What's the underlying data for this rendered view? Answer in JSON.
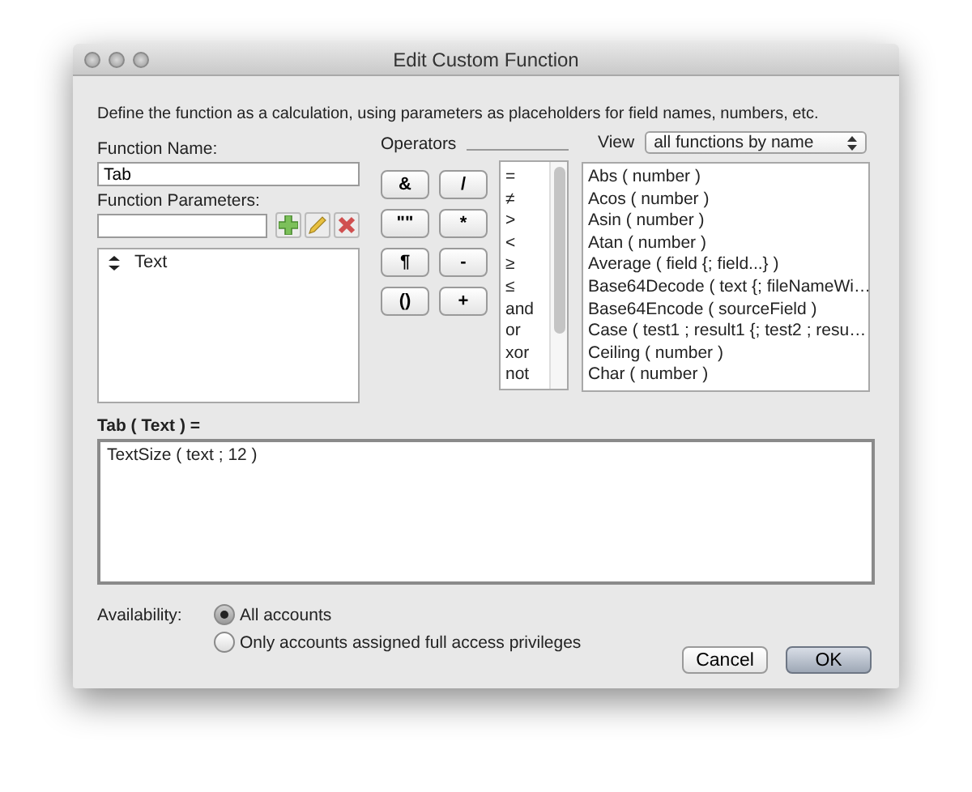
{
  "window": {
    "title": "Edit Custom Function"
  },
  "description": "Define the function as a calculation, using parameters as placeholders for field names, numbers, etc.",
  "function_name": {
    "label": "Function Name:",
    "value": "Tab"
  },
  "function_parameters": {
    "label": "Function Parameters:",
    "items": [
      {
        "label": "Text"
      }
    ]
  },
  "operators": {
    "label": "Operators",
    "buttons": [
      "&",
      "/",
      "\"\"",
      "*",
      "¶",
      "-",
      "()",
      "+"
    ],
    "list": [
      "=",
      "≠",
      ">",
      "<",
      "≥",
      "≤",
      "and",
      "or",
      "xor",
      "not"
    ]
  },
  "view": {
    "label": "View",
    "value": "all functions by name"
  },
  "functions": [
    "Abs ( number )",
    "Acos ( number )",
    "Asin ( number )",
    "Atan ( number )",
    "Average ( field {; field...} )",
    "Base64Decode ( text {; fileNameWi…",
    "Base64Encode ( sourceField )",
    "Case ( test1 ; result1 {; test2 ; resu…",
    "Ceiling ( number )",
    "Char ( number )"
  ],
  "formula": {
    "label": "Tab ( Text ) =",
    "value": "TextSize ( text ; 12 )"
  },
  "availability": {
    "label": "Availability:",
    "options": [
      {
        "label": "All accounts",
        "selected": true
      },
      {
        "label": "Only accounts assigned full access privileges",
        "selected": false
      }
    ]
  },
  "buttons": [
    {
      "label": "Cancel",
      "default": false
    },
    {
      "label": "OK",
      "default": true
    }
  ]
}
